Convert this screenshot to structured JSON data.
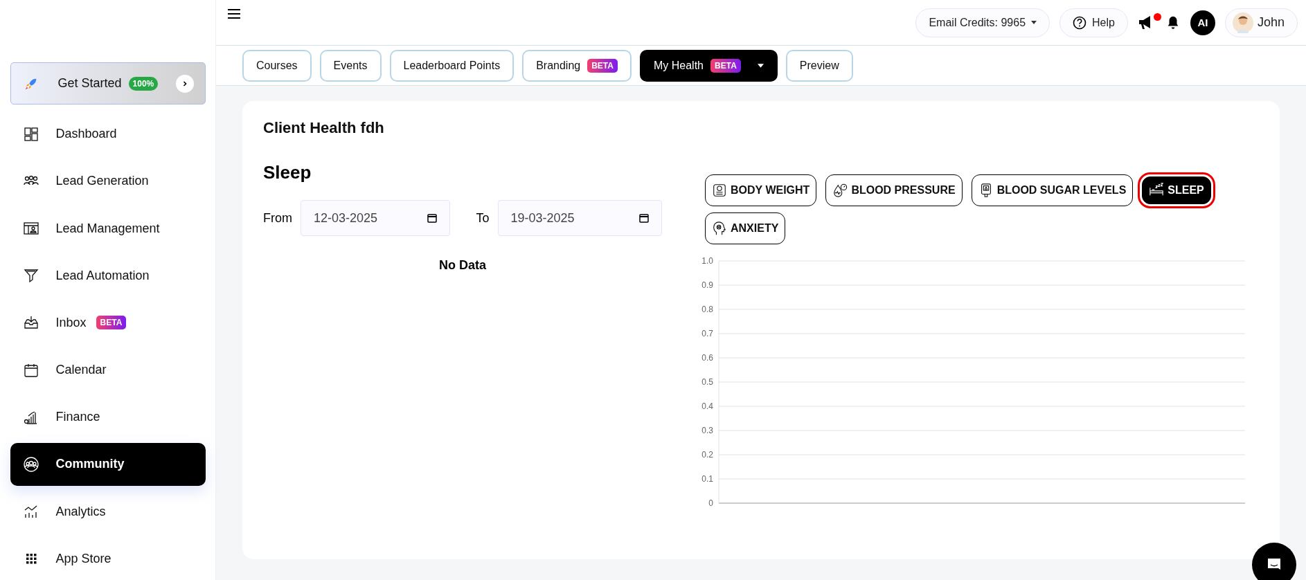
{
  "get_started": {
    "label": "Get Started",
    "badge": "100%"
  },
  "sidebar": {
    "items": [
      {
        "label": "Dashboard",
        "kind": "dashboard",
        "selected": false
      },
      {
        "label": "Lead Generation",
        "kind": "people",
        "selected": false
      },
      {
        "label": "Lead Management",
        "kind": "contact",
        "selected": false
      },
      {
        "label": "Lead Automation",
        "kind": "funnel",
        "selected": false
      },
      {
        "label": "Inbox",
        "kind": "inbox",
        "selected": false,
        "badge": "BETA"
      },
      {
        "label": "Calendar",
        "kind": "calendar",
        "selected": false
      },
      {
        "label": "Finance",
        "kind": "finance",
        "selected": false
      },
      {
        "label": "Community",
        "kind": "community",
        "selected": true
      },
      {
        "label": "Analytics",
        "kind": "analytics",
        "selected": false
      },
      {
        "label": "App Store",
        "kind": "apps",
        "selected": false
      }
    ]
  },
  "header": {
    "email_credits": "Email Credits: 9965",
    "help": "Help",
    "notification_dot": true,
    "avatar_initials": "AI",
    "user": "John"
  },
  "tabs": [
    {
      "label": "Courses",
      "selected": false
    },
    {
      "label": "Events",
      "selected": false
    },
    {
      "label": "Leaderboard Points",
      "selected": false
    },
    {
      "label": "Branding",
      "selected": false,
      "badge": "BETA"
    },
    {
      "label": "My Health",
      "selected": true,
      "badge": "BETA",
      "dropdown": true
    },
    {
      "label": "Preview",
      "selected": false
    }
  ],
  "card": {
    "title": "Client Health fdh",
    "section": "Sleep",
    "from_label": "From",
    "from": "12-03-2025",
    "to_label": "To",
    "to": "19-03-2025",
    "empty": "No Data"
  },
  "metrics": [
    {
      "label": "BODY WEIGHT",
      "kind": "scale",
      "selected": false
    },
    {
      "label": "BLOOD PRESSURE",
      "kind": "pressure",
      "selected": false
    },
    {
      "label": "BLOOD SUGAR LEVELS",
      "kind": "glucose",
      "selected": false
    },
    {
      "label": "SLEEP",
      "kind": "bed",
      "selected": true
    },
    {
      "label": "ANXIETY",
      "kind": "head",
      "selected": false
    }
  ],
  "chart_axis": {
    "ticks": [
      "1.0",
      "0.9",
      "0.8",
      "0.7",
      "0.6",
      "0.5",
      "0.4",
      "0.3",
      "0.2",
      "0.1",
      "0"
    ]
  }
}
